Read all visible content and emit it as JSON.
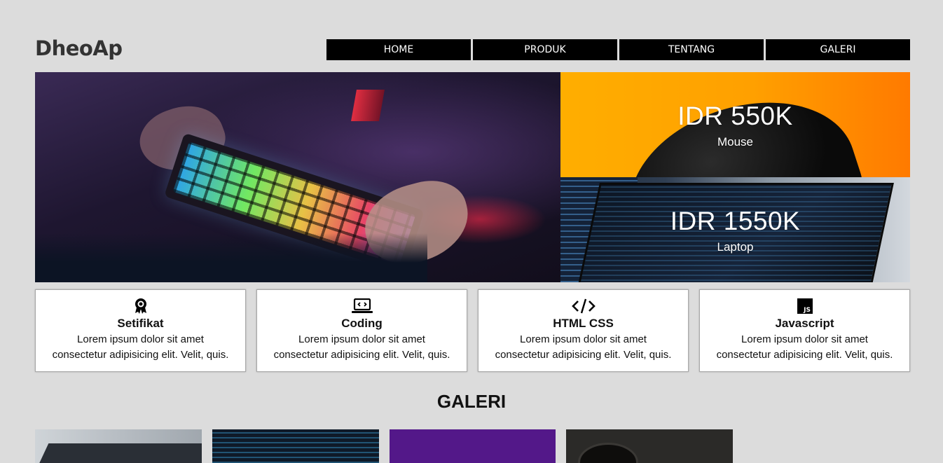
{
  "brand": "DheoAp",
  "nav": {
    "items": [
      {
        "label": "HOME"
      },
      {
        "label": "PRODUK"
      },
      {
        "label": "TENTANG"
      },
      {
        "label": "GALERI"
      }
    ]
  },
  "hero": {
    "promos": [
      {
        "price": "IDR 550K",
        "label": "Mouse"
      },
      {
        "price": "IDR 1550K",
        "label": "Laptop"
      }
    ]
  },
  "features": [
    {
      "icon": "award-icon",
      "title": "Setifikat",
      "desc1": "Lorem ipsum dolor sit amet",
      "desc2": "consectetur adipisicing elit. Velit, quis."
    },
    {
      "icon": "laptop-code-icon",
      "title": "Coding",
      "desc1": "Lorem ipsum dolor sit amet",
      "desc2": "consectetur adipisicing elit. Velit, quis."
    },
    {
      "icon": "code-icon",
      "title": "HTML CSS",
      "desc1": "Lorem ipsum dolor sit amet",
      "desc2": "consectetur adipisicing elit. Velit, quis."
    },
    {
      "icon": "js-icon",
      "title": "Javascript",
      "desc1": "Lorem ipsum dolor sit amet",
      "desc2": "consectetur adipisicing elit. Velit, quis."
    }
  ],
  "gallery": {
    "title": "GALERI"
  },
  "colors": {
    "background": "#dcdcdc",
    "nav_bg": "#000000",
    "promo_orange": "#ffa000",
    "gallery_purple": "#531889"
  }
}
